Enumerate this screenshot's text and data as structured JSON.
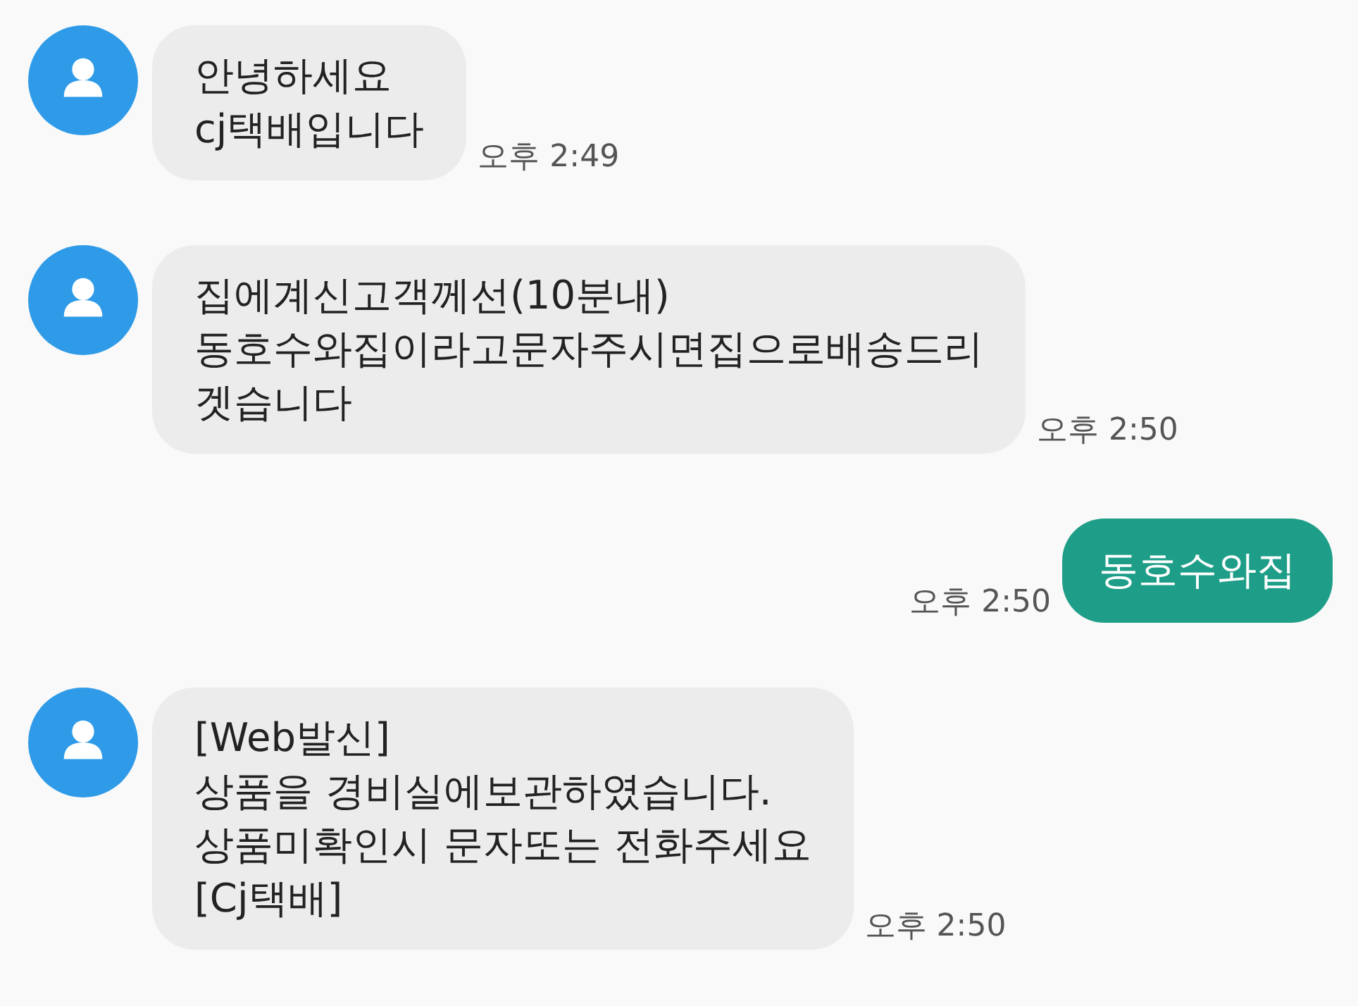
{
  "messages": [
    {
      "kind": "incoming",
      "text": "안녕하세요\ncj택배입니다",
      "time": "오후 2:49"
    },
    {
      "kind": "incoming",
      "text": "집에계신고객께선(10분내)\n동호수와집이라고문자주시면집으로배송드리\n겟습니다",
      "time": "오후 2:50"
    },
    {
      "kind": "outgoing",
      "text": "동호수와집",
      "time": "오후 2:50"
    },
    {
      "kind": "incoming",
      "text": "[Web발신]\n상품을 경비실에보관하였습니다.\n상품미확인시 문자또는 전화주세요\n[Cj택배]",
      "time": "오후 2:50"
    }
  ]
}
